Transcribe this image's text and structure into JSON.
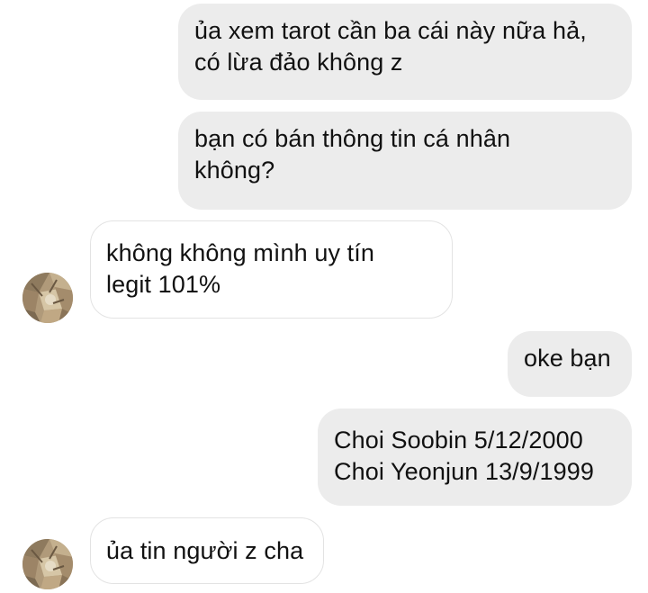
{
  "conversation": {
    "messages": [
      {
        "direction": "sent",
        "text": "ủa xem tarot cần ba cái này nữa hả,\ncó lừa đảo không z"
      },
      {
        "direction": "sent",
        "text": "bạn có bán thông tin cá nhân\nkhông?"
      },
      {
        "direction": "received",
        "text": "không không mình uy tín\nlegit 101%"
      },
      {
        "direction": "sent",
        "text": "oke bạn"
      },
      {
        "direction": "sent",
        "text": "Choi Soobin 5/12/2000\nChoi Yeonjun 13/9/1999"
      },
      {
        "direction": "received",
        "text": "ủa tin người z cha"
      }
    ]
  },
  "colors": {
    "sent_bubble": "#ececec",
    "received_bubble_border": "#e3e3e3",
    "text": "#111111"
  }
}
